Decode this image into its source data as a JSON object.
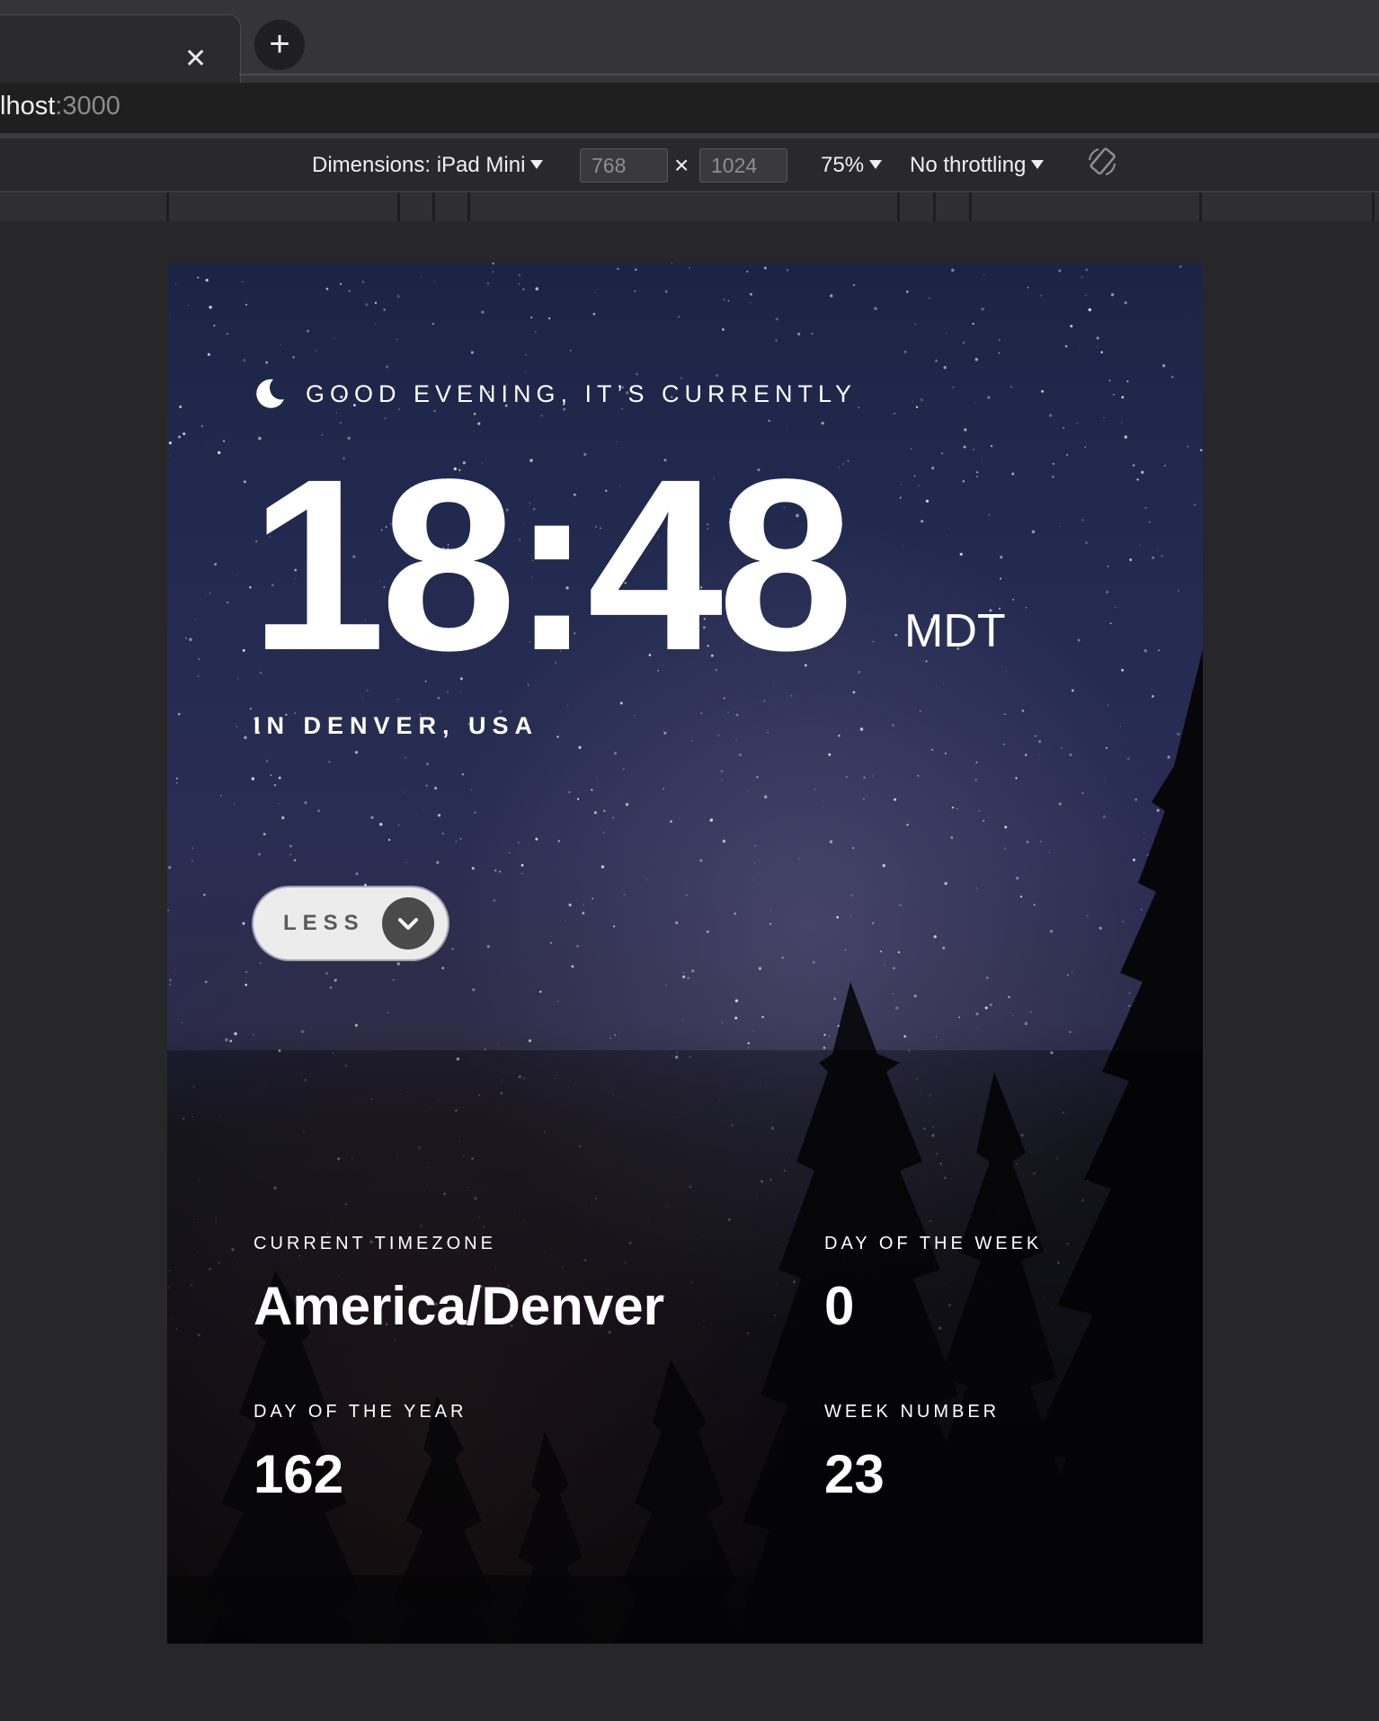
{
  "browser": {
    "url_host": "lhost",
    "url_port": ":3000",
    "new_tab_symbol": "+",
    "close_symbol": "✕"
  },
  "devtools": {
    "dimensions_label": "Dimensions: iPad Mini",
    "width_value": "768",
    "height_value": "1024",
    "times_symbol": "×",
    "zoom_label": "75%",
    "throttling_label": "No throttling"
  },
  "app": {
    "greeting": "GOOD EVENING, IT’S CURRENTLY",
    "time": "18:48",
    "timezone_abbr": "MDT",
    "location": "IN DENVER, USA",
    "toggle_label": "LESS",
    "details": {
      "current_timezone_label": "CURRENT TIMEZONE",
      "current_timezone_value": "America/Denver",
      "day_of_week_label": "DAY OF THE WEEK",
      "day_of_week_value": "0",
      "day_of_year_label": "DAY OF THE YEAR",
      "day_of_year_value": "162",
      "week_number_label": "WEEK NUMBER",
      "week_number_value": "23"
    }
  },
  "colors": {
    "chrome_bg": "#353537",
    "page_bg": "#272729",
    "toggle_bg": "#ececec",
    "toggle_button": "#4a4a4a"
  },
  "icons": {
    "greeting_icon": "moon-icon",
    "toggle_icon": "chevron-down-icon",
    "rotate_icon": "rotate-device-icon"
  }
}
